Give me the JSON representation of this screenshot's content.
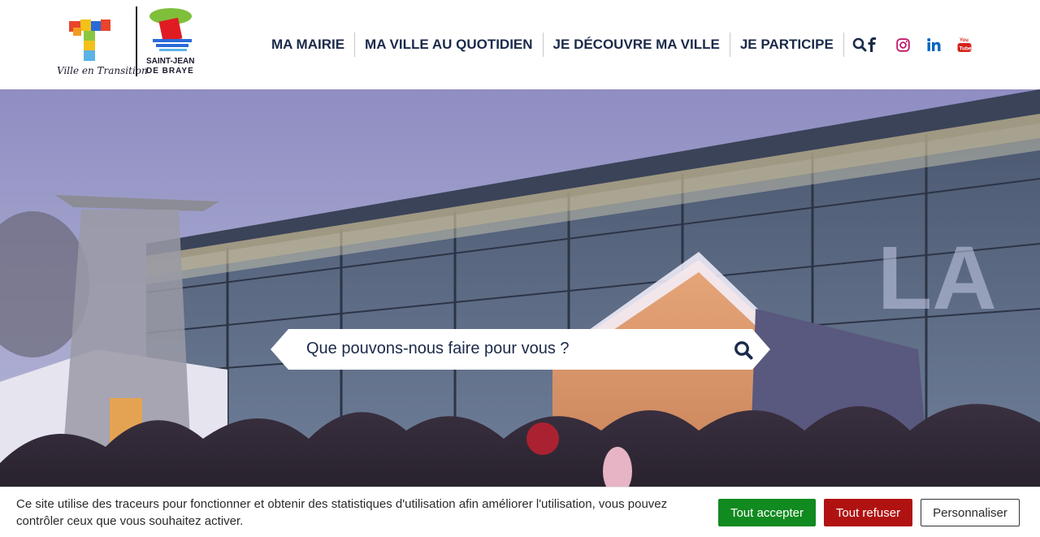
{
  "logo": {
    "tagline": "Ville en Transition",
    "city_line1": "SAINT-JEAN",
    "city_line2": "DE BRAYE"
  },
  "nav": {
    "items": [
      {
        "label": "MA MAIRIE"
      },
      {
        "label": "MA VILLE AU QUOTIDIEN"
      },
      {
        "label": "JE DÉCOUVRE MA VILLE"
      },
      {
        "label": "JE PARTICIPE"
      }
    ],
    "search_icon": "search-icon"
  },
  "socials": [
    {
      "icon": "facebook-icon"
    },
    {
      "icon": "instagram-icon"
    },
    {
      "icon": "linkedin-icon"
    },
    {
      "icon": "youtube-icon",
      "label": "You Tube"
    }
  ],
  "hero": {
    "search_placeholder": "Que pouvons-nous faire pour vous ?",
    "sign_text": "LA"
  },
  "cookie": {
    "text": "Ce site utilise des traceurs pour fonctionner et obtenir des statistiques d'utilisation afin améliorer l'utilisation, vous pouvez contrôler ceux que vous souhaitez activer.",
    "accept_label": "Tout accepter",
    "refuse_label": "Tout refuser",
    "customize_label": "Personnaliser"
  },
  "colors": {
    "nav_text": "#1b2a4a",
    "accept": "#118a20",
    "refuse": "#b01212"
  }
}
